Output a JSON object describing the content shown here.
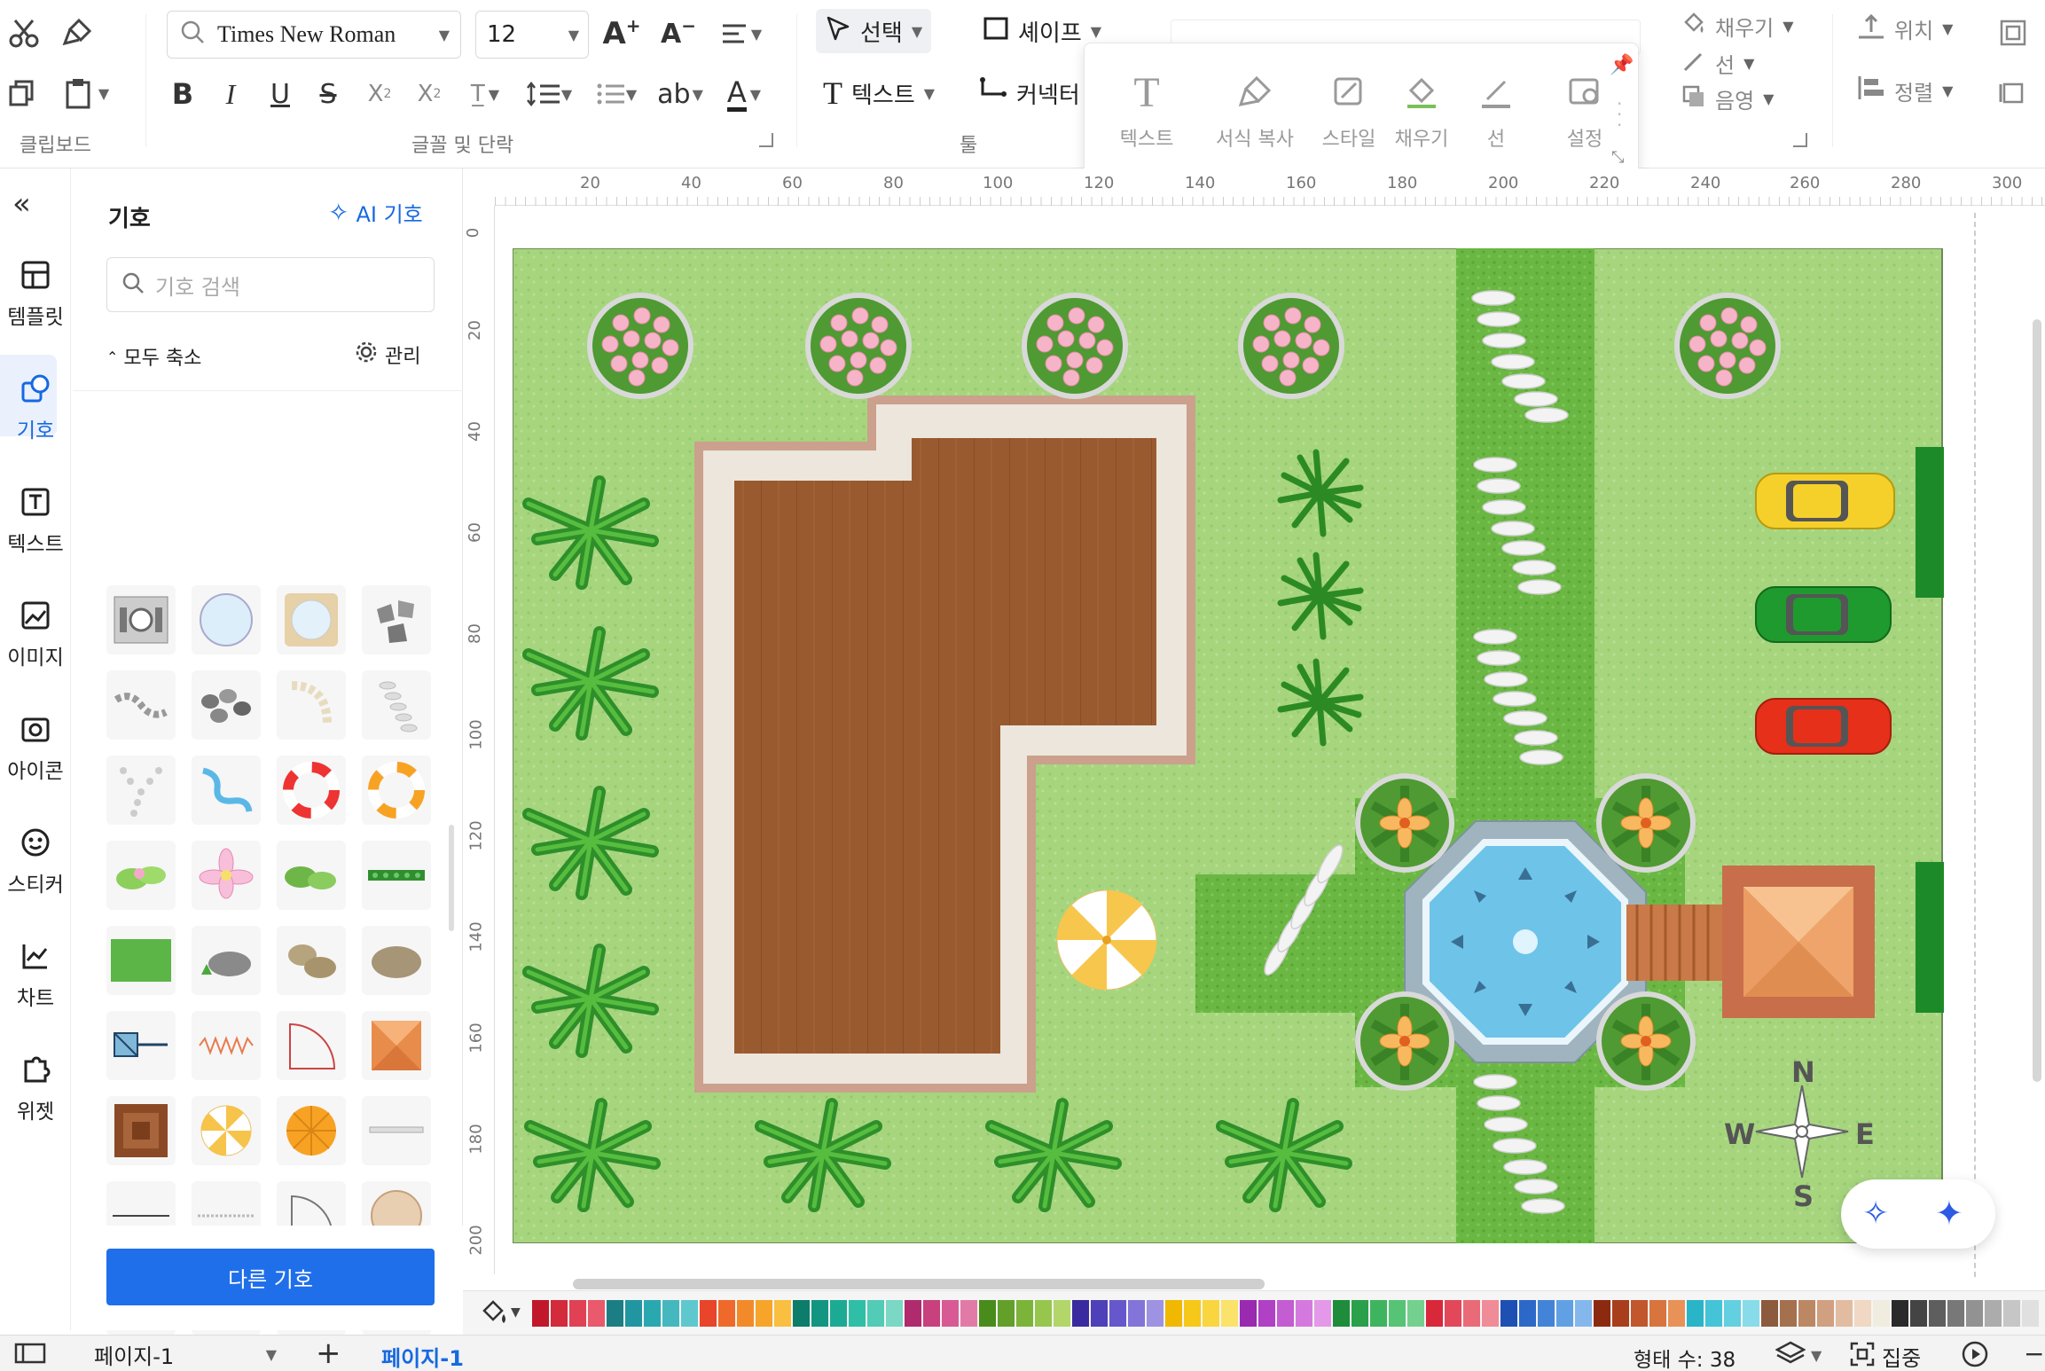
{
  "ribbon": {
    "groups": {
      "clipboard": "클립보드",
      "font_para": "글꼴 및 단락",
      "tools": "툴"
    },
    "font_name": "Times New Roman",
    "font_size": "12",
    "select_label": "선택",
    "shape_label": "셰이프",
    "text_label": "텍스트",
    "connector_label": "커넥터",
    "fill_label": "채우기",
    "line_label": "선",
    "shadow_label": "음영",
    "position_label": "위치",
    "align_label": "정렬",
    "ab_label": "ab"
  },
  "floating_toolbar": {
    "items": [
      "텍스트",
      "서식 복사",
      "스타일",
      "채우기",
      "선",
      "설정"
    ]
  },
  "rail": {
    "items": [
      {
        "label": "템플릿",
        "icon": "template-icon"
      },
      {
        "label": "기호",
        "icon": "symbol-icon"
      },
      {
        "label": "텍스트",
        "icon": "text-icon"
      },
      {
        "label": "이미지",
        "icon": "image-icon"
      },
      {
        "label": "아이콘",
        "icon": "camera-icon"
      },
      {
        "label": "스티커",
        "icon": "sticker-icon"
      },
      {
        "label": "차트",
        "icon": "chart-icon"
      },
      {
        "label": "위젯",
        "icon": "widget-icon"
      }
    ]
  },
  "panel": {
    "title": "기호",
    "ai_label": "AI 기호",
    "search_placeholder": "기호 검색",
    "collapse_all": "모두 축소",
    "manage": "관리",
    "more_button": "다른 기호"
  },
  "ruler": {
    "top": [
      "20",
      "40",
      "60",
      "80",
      "100",
      "120",
      "140",
      "160",
      "180",
      "200",
      "220",
      "240",
      "260",
      "280",
      "300"
    ],
    "left": [
      "0",
      "20",
      "40",
      "60",
      "80",
      "100",
      "120",
      "140",
      "160",
      "180",
      "200"
    ]
  },
  "compass": {
    "n": "N",
    "s": "S",
    "e": "E",
    "w": "W"
  },
  "status": {
    "page_select": "페이지-1",
    "active_tab": "페이지-1",
    "shape_count": "형태 수: 38",
    "focus": "집중"
  },
  "palette": [
    "#c0182a",
    "#d32a3c",
    "#e04155",
    "#e85a6c",
    "#1c7e85",
    "#2196a0",
    "#2aa8b0",
    "#45b8bf",
    "#5fc8cf",
    "#e8452a",
    "#ef6a2a",
    "#f38a2a",
    "#f6a52a",
    "#f8bf40",
    "#0c7d6a",
    "#129682",
    "#1caa94",
    "#2fbea6",
    "#52ccb6",
    "#7ad8c5",
    "#b02a6e",
    "#c8407e",
    "#d85a94",
    "#e27aa8",
    "#4a8c1c",
    "#62a02a",
    "#7cb43a",
    "#96c64e",
    "#b2d66a",
    "#3a2aa0",
    "#4e40b8",
    "#6658cc",
    "#8274d8",
    "#9e92e2",
    "#f0b800",
    "#f6c81a",
    "#f9d640",
    "#fbe26a",
    "#9a2ab0",
    "#b040c4",
    "#c45cd2",
    "#d47ade",
    "#e498e8",
    "#1e8c3a",
    "#2aa04a",
    "#3eb45e",
    "#56c474",
    "#74d08e",
    "#d8283a",
    "#e2485a",
    "#ea6a78",
    "#f08c98",
    "#1e50b4",
    "#2c68c8",
    "#4484d8",
    "#62a0e4",
    "#84b8ec",
    "#8c2a10",
    "#a83e1c",
    "#c2562c",
    "#d8743e",
    "#e89258",
    "#2ab4c8",
    "#44c4d6",
    "#62d0e0",
    "#88dcea",
    "#8c5a3c",
    "#a4704e",
    "#bc8864",
    "#d0a080",
    "#e2bca0",
    "#f0d8c4",
    "#f0ece0",
    "#2a2a2a",
    "#444444",
    "#5e5e5e",
    "#787878",
    "#929292",
    "#acacac",
    "#c6c6c6",
    "#e0e0e0"
  ]
}
